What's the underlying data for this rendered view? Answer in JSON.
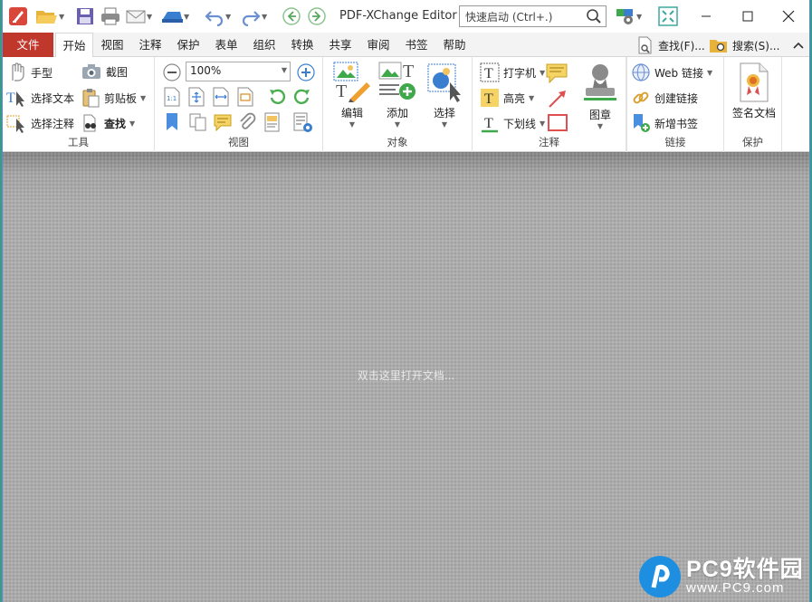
{
  "app": {
    "title": "PDF-XChange Editor",
    "quick_launch_placeholder": "快速启动 (Ctrl+.)"
  },
  "menu": {
    "tabs": [
      "文件",
      "开始",
      "视图",
      "注释",
      "保护",
      "表单",
      "组织",
      "转换",
      "共享",
      "审阅",
      "书签",
      "帮助"
    ],
    "active_tab": "开始",
    "find_label": "查找(F)...",
    "search_label": "搜索(S)..."
  },
  "ribbon": {
    "tools": {
      "label": "工具",
      "hand": "手型",
      "snapshot": "截图",
      "select_text": "选择文本",
      "clipboard": "剪贴板",
      "select_comment": "选择注释",
      "find": "查找"
    },
    "view": {
      "label": "视图",
      "zoom": "100%"
    },
    "objects": {
      "label": "对象",
      "edit": "编辑",
      "add": "添加",
      "select": "选择"
    },
    "comments": {
      "label": "注释",
      "typewriter": "打字机",
      "highlight": "高亮",
      "underline": "下划线"
    },
    "stamp": {
      "label": "图章"
    },
    "links": {
      "label": "链接",
      "web_link": "Web 链接",
      "create_link": "创建链接",
      "add_bookmark": "新增书签"
    },
    "protect": {
      "label": "保护",
      "sign": "签名文档"
    }
  },
  "document": {
    "hint": "双击这里打开文档..."
  },
  "watermark": {
    "name": "PC9软件园",
    "url": "www.PC9.com"
  },
  "colors": {
    "file_tab": "#c0382b",
    "accent_green": "#3fa84a",
    "accent_blue": "#1e8fe0"
  }
}
